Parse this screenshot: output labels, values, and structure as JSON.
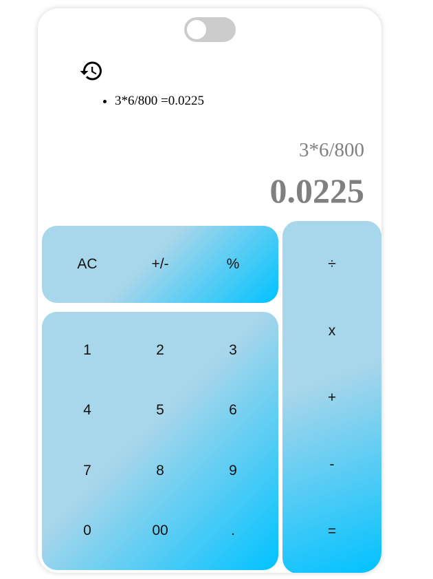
{
  "history": {
    "entries": [
      "3*6/800 =0.0225"
    ]
  },
  "display": {
    "expression": "3*6/800",
    "result": "0.0225"
  },
  "keypad": {
    "top_row": [
      "AC",
      "+/-",
      "%"
    ],
    "digits": [
      [
        "1",
        "2",
        "3"
      ],
      [
        "4",
        "5",
        "6"
      ],
      [
        "7",
        "8",
        "9"
      ],
      [
        "0",
        "00",
        "."
      ]
    ],
    "operators": [
      "÷",
      "x",
      "+",
      "-",
      "="
    ]
  },
  "theme": {
    "accent_light": "#a8d6ea",
    "accent_strong": "#00c2ff",
    "toggle_off": "#cccccc",
    "display_text": "#808080"
  },
  "icons": {
    "history": "history-icon",
    "toggle": "theme-toggle"
  }
}
